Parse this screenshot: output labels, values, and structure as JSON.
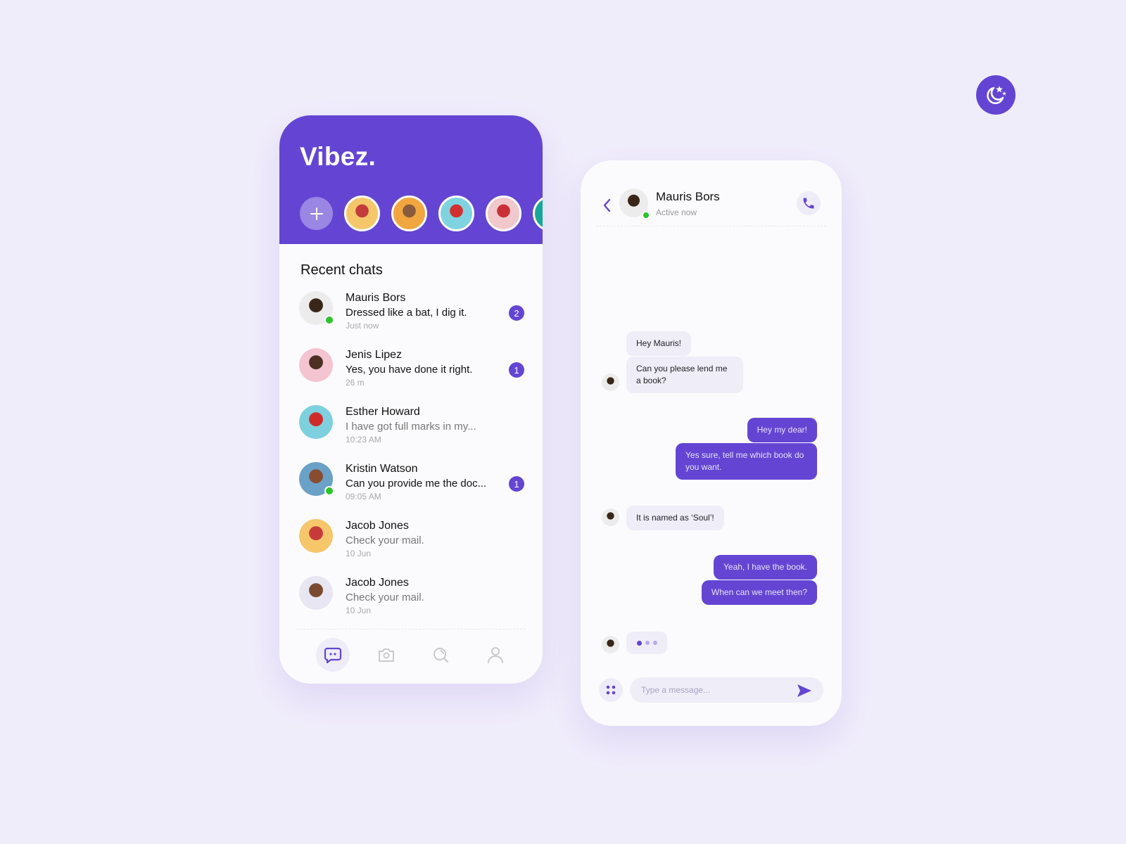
{
  "colors": {
    "accent": "#6445d3",
    "background": "#f0edfb",
    "online": "#2bc42a"
  },
  "theme_toggle": {
    "icon": "moon-stars-icon"
  },
  "list_screen": {
    "app_title": "Vibez.",
    "add_story_icon": "plus-icon",
    "stories": [
      {
        "name": "story-1",
        "colors": [
          "#f6c66b",
          "#c43b3b"
        ]
      },
      {
        "name": "story-2",
        "colors": [
          "#f1a640",
          "#8a5a3c"
        ]
      },
      {
        "name": "story-3",
        "colors": [
          "#7fd3e0",
          "#d22f2f"
        ]
      },
      {
        "name": "story-4",
        "colors": [
          "#f1c8cc",
          "#c93038"
        ]
      },
      {
        "name": "story-5",
        "colors": [
          "#19a69a",
          "#e9c49a"
        ]
      }
    ],
    "section_title": "Recent chats",
    "chats": [
      {
        "name": "Mauris Bors",
        "message": "Dressed like a bat, I dig it.",
        "time": "Just now",
        "unread": "2",
        "online": true,
        "read": false,
        "avatar_colors": [
          "#ececec",
          "#3a2618"
        ]
      },
      {
        "name": "Jenis Lipez",
        "message": "Yes, you have done it right.",
        "time": "26 m",
        "unread": "1",
        "online": false,
        "read": false,
        "avatar_colors": [
          "#f4c4d0",
          "#4c3022"
        ]
      },
      {
        "name": "Esther Howard",
        "message": "I have got full marks in my...",
        "time": "10:23 AM",
        "unread": null,
        "online": false,
        "read": true,
        "avatar_colors": [
          "#7fd0de",
          "#cf2a2a"
        ]
      },
      {
        "name": "Kristin Watson",
        "message": "Can you provide me the doc...",
        "time": "09:05 AM",
        "unread": "1",
        "online": true,
        "read": false,
        "avatar_colors": [
          "#6aa1c7",
          "#8a4c30"
        ]
      },
      {
        "name": "Jacob Jones",
        "message": "Check your mail.",
        "time": "10 Jun",
        "unread": null,
        "online": false,
        "read": true,
        "avatar_colors": [
          "#f6c66b",
          "#c83a3a"
        ]
      },
      {
        "name": "Jacob Jones",
        "message": "Check your mail.",
        "time": "10 Jun",
        "unread": null,
        "online": false,
        "read": true,
        "avatar_colors": [
          "#e8e6f2",
          "#7a4a30"
        ]
      }
    ],
    "bottom_nav": [
      {
        "name": "chats",
        "icon": "chat-bubble-icon",
        "active": true
      },
      {
        "name": "camera",
        "icon": "camera-icon",
        "active": false
      },
      {
        "name": "search",
        "icon": "search-icon",
        "active": false
      },
      {
        "name": "profile",
        "icon": "user-icon",
        "active": false
      }
    ]
  },
  "chat_screen": {
    "contact_name": "Mauris Bors",
    "contact_status": "Active now",
    "back_icon": "chevron-left-icon",
    "call_icon": "phone-icon",
    "messages": [
      {
        "direction": "in",
        "text": "Hey Mauris!"
      },
      {
        "direction": "in",
        "text": "Can you please lend me a book?"
      },
      {
        "direction": "out",
        "text": "Hey my dear!"
      },
      {
        "direction": "out",
        "text": "Yes sure, tell me which book do you want."
      },
      {
        "direction": "in",
        "text": "It is named as ‘Soul’!"
      },
      {
        "direction": "out",
        "text": "Yeah, I have the book."
      },
      {
        "direction": "out",
        "text": "When can we meet then?"
      }
    ],
    "typing_indicator": true,
    "composer": {
      "placeholder": "Type a message...",
      "value": "",
      "apps_icon": "grid-dots-icon",
      "send_icon": "send-icon"
    }
  }
}
